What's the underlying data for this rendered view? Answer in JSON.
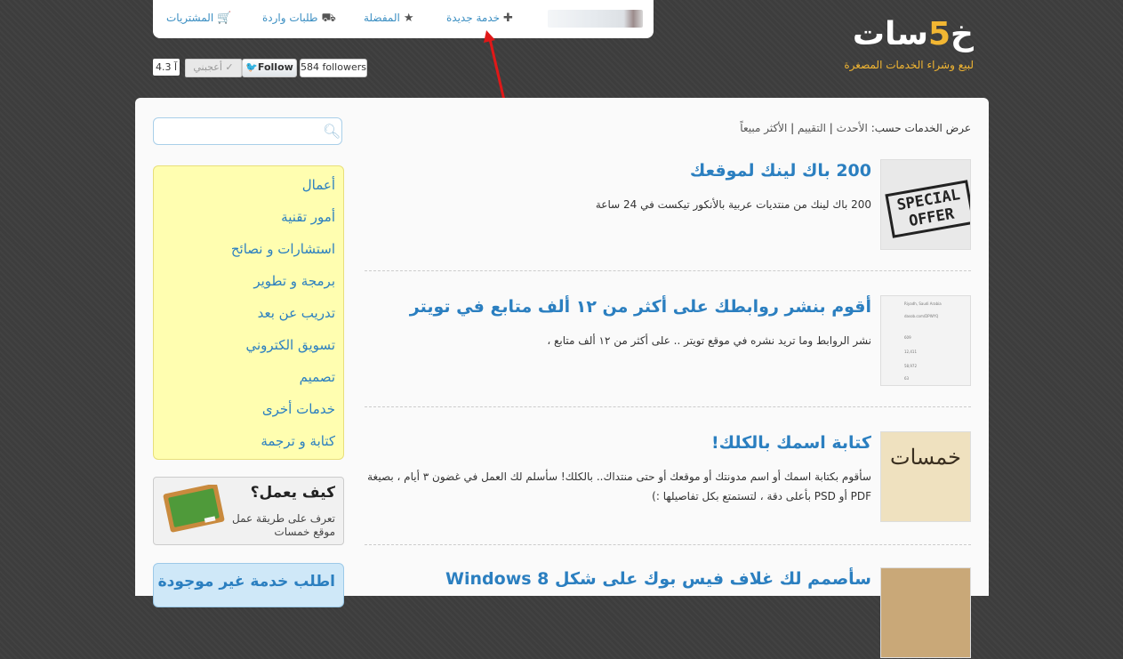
{
  "nav": {
    "purchases": "المشتريات",
    "incoming": "طلبات واردة",
    "favorites": "المفضلة",
    "new_service": "خدمة جديدة"
  },
  "logo": {
    "name_start": "خ",
    "name_digit": "5",
    "name_end": "سات",
    "tagline": "لبيع وشراء الخدمات المصغرة"
  },
  "social": {
    "rating": "4.3 آ",
    "like": "✓ أعجبني",
    "follow": "Follow",
    "followers": "584 followers"
  },
  "search": {
    "placeholder": "",
    "value": ""
  },
  "categories": [
    "أعمال",
    "أمور تقنية",
    "استشارات و نصائح",
    "برمجة و تطوير",
    "تدريب عن بعد",
    "تسويق الكتروني",
    "تصميم",
    "خدمات أخرى",
    "كتابة و ترجمة"
  ],
  "howto": {
    "title": "كيف يعمل؟",
    "desc": "تعرف على طريقة عمل موقع خمسات"
  },
  "askbox": {
    "title": "اطلب خدمة غير موجودة"
  },
  "sort": {
    "label": "عرض الخدمات حسب:",
    "newest": "الأحدث",
    "rating": "التقييم",
    "bestselling": "الأكثر مبيعاً",
    "sep": "|"
  },
  "services": [
    {
      "title": "200 باك لينك لموقعك",
      "desc": "200 باك لينك من منتديات عربية بالأنكور تيكست في 24 ساعة",
      "thumb_text": "SPECIAL OFFER"
    },
    {
      "title": "أقوم بنشر روابطك على أكثر من ١٢ ألف متابع في تويتر",
      "desc": "نشر الروابط وما تريد نشره في موقع تويتر .. على أكثر من ١٢ ألف متابع ،",
      "thumb_rows": [
        "Riyadh, Saudi Arabia",
        "dasob.com/DPWYQ",
        "609",
        "12,411",
        "58,972",
        "63"
      ]
    },
    {
      "title": "كتابة اسمك بالكلك!",
      "desc": "سأقوم بكتابة اسمك أو اسم مدونتك أو موقعك أو حتى منتداك.. بالكلك! سأسلم لك العمل في غضون ٣ أيام ، بصيغة PDF أو PSD بأعلى دقة ، لتستمتع بكل تفاصيلها :)",
      "thumb_text": "خمسات"
    },
    {
      "title": "سأصمم لك غلاف فيس بوك على شكل Windows 8",
      "desc": ""
    }
  ]
}
